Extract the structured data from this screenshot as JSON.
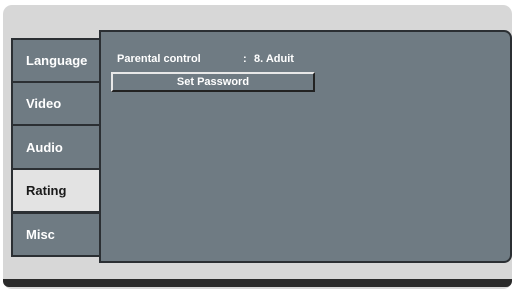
{
  "tabs": [
    {
      "label": "Language",
      "selected": false
    },
    {
      "label": "Video",
      "selected": false
    },
    {
      "label": "Audio",
      "selected": false
    },
    {
      "label": "Rating",
      "selected": true
    },
    {
      "label": "Misc",
      "selected": false
    }
  ],
  "rating_page": {
    "parental_control_label": "Parental control",
    "separator": ":",
    "parental_control_value": "8. Aduit",
    "set_password_label": "Set Password"
  },
  "colors": {
    "panel": "#6f7b83",
    "selected_tab": "#e3e3e3",
    "background": "#d7d7d7",
    "border": "#2b2f33"
  }
}
